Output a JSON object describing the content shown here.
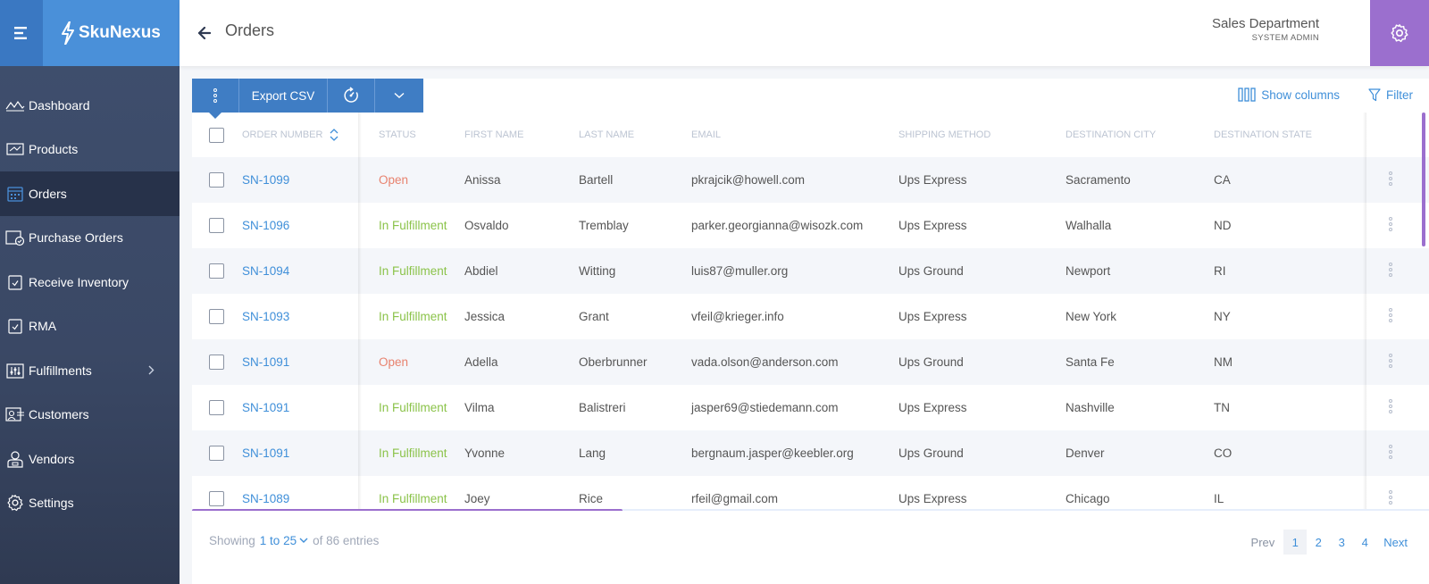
{
  "brand": {
    "name": "SkuNexus"
  },
  "header": {
    "title": "Orders",
    "department": "Sales Department",
    "role": "SYSTEM ADMIN"
  },
  "sidebar": {
    "items": [
      {
        "label": "Dashboard",
        "icon": "dashboard-icon"
      },
      {
        "label": "Products",
        "icon": "products-icon"
      },
      {
        "label": "Orders",
        "icon": "orders-icon",
        "active": true
      },
      {
        "label": "Purchase Orders",
        "icon": "purchase-orders-icon"
      },
      {
        "label": "Receive Inventory",
        "icon": "receive-inventory-icon"
      },
      {
        "label": "RMA",
        "icon": "rma-icon"
      },
      {
        "label": "Fulfillments",
        "icon": "fulfillments-icon",
        "has_submenu": true
      },
      {
        "label": "Customers",
        "icon": "customers-icon"
      },
      {
        "label": "Vendors",
        "icon": "vendors-icon"
      },
      {
        "label": "Settings",
        "icon": "settings-icon"
      }
    ]
  },
  "toolbar": {
    "export_label": "Export CSV",
    "show_columns_label": "Show columns",
    "filter_label": "Filter"
  },
  "table": {
    "columns": {
      "order_number": "ORDER NUMBER",
      "status": "STATUS",
      "first_name": "FIRST NAME",
      "last_name": "LAST NAME",
      "email": "EMAIL",
      "shipping_method": "SHIPPING METHOD",
      "destination_city": "DESTINATION CITY",
      "destination_state": "DESTINATION STATE"
    },
    "rows": [
      {
        "number": "SN-1099",
        "status": "Open",
        "first": "Anissa",
        "last": "Bartell",
        "email": "pkrajcik@howell.com",
        "ship": "Ups Express",
        "city": "Sacramento",
        "state": "CA"
      },
      {
        "number": "SN-1096",
        "status": "In Fulfillment",
        "first": "Osvaldo",
        "last": "Tremblay",
        "email": "parker.georgianna@wisozk.com",
        "ship": "Ups Express",
        "city": "Walhalla",
        "state": "ND"
      },
      {
        "number": "SN-1094",
        "status": "In Fulfillment",
        "first": "Abdiel",
        "last": "Witting",
        "email": "luis87@muller.org",
        "ship": "Ups Ground",
        "city": "Newport",
        "state": "RI"
      },
      {
        "number": "SN-1093",
        "status": "In Fulfillment",
        "first": "Jessica",
        "last": "Grant",
        "email": "vfeil@krieger.info",
        "ship": "Ups Express",
        "city": "New York",
        "state": "NY"
      },
      {
        "number": "SN-1091",
        "status": "Open",
        "first": "Adella",
        "last": "Oberbrunner",
        "email": "vada.olson@anderson.com",
        "ship": "Ups Ground",
        "city": "Santa Fe",
        "state": "NM"
      },
      {
        "number": "SN-1091",
        "status": "In Fulfillment",
        "first": "Vilma",
        "last": "Balistreri",
        "email": "jasper69@stiedemann.com",
        "ship": "Ups Express",
        "city": "Nashville",
        "state": "TN"
      },
      {
        "number": "SN-1091",
        "status": "In Fulfillment",
        "first": "Yvonne",
        "last": "Lang",
        "email": "bergnaum.jasper@keebler.org",
        "ship": "Ups Ground",
        "city": "Denver",
        "state": "CO"
      },
      {
        "number": "SN-1089",
        "status": "In Fulfillment",
        "first": "Joey",
        "last": "Rice",
        "email": "rfeil@gmail.com",
        "ship": "Ups Express",
        "city": "Chicago",
        "state": "IL"
      }
    ]
  },
  "footer": {
    "showing_label": "Showing",
    "range": "1 to 25",
    "total_text": "of 86 entries"
  },
  "pagination": {
    "prev": "Prev",
    "pages": [
      "1",
      "2",
      "3",
      "4"
    ],
    "current": "1",
    "next": "Next"
  },
  "colors": {
    "brand": "#4a90d9",
    "accent": "#9b6fce",
    "link": "#3f8fd9",
    "status_open": "#e8826e",
    "status_fulfillment": "#8bc34a"
  }
}
